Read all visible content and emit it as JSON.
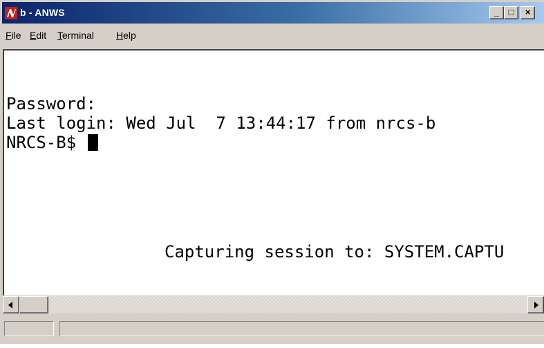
{
  "window": {
    "title": "b - ANWS",
    "minimize_glyph": "_",
    "maximize_glyph": "□",
    "close_glyph": "×"
  },
  "menu": {
    "items": [
      {
        "underline": "F",
        "rest": "ile"
      },
      {
        "underline": "E",
        "rest": "dit"
      },
      {
        "underline": "T",
        "rest": "erminal"
      },
      {
        "underline": "H",
        "rest": "elp"
      }
    ]
  },
  "terminal": {
    "lines": [
      "Password:",
      "Last login: Wed Jul  7 13:44:17 from nrcs-b",
      "NRCS-B$ "
    ],
    "capture_message": "Capturing session to: SYSTEM.CAPTU"
  },
  "status": {
    "pane1": "",
    "pane2": ""
  },
  "colors": {
    "titlebar_start": "#0a246a",
    "titlebar_end": "#a6caf0",
    "chrome": "#d4d0c8",
    "terminal_bg": "#ffffff",
    "terminal_fg": "#000000"
  }
}
